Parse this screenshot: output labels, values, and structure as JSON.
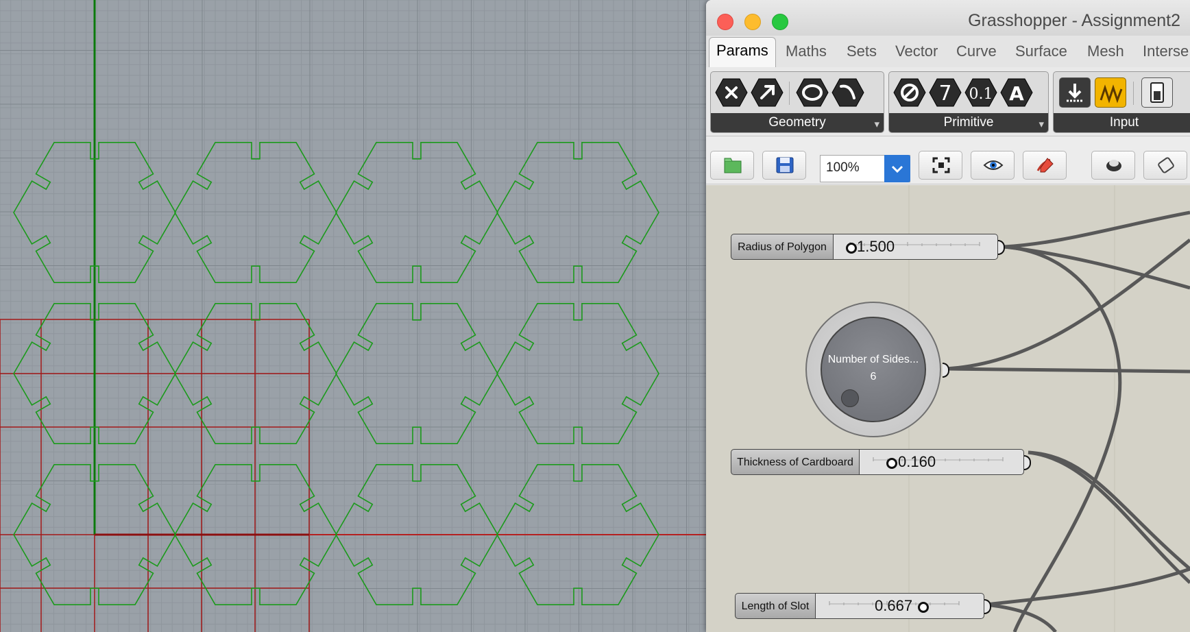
{
  "window": {
    "title": "Grasshopper - Assignment2"
  },
  "tabs": [
    "Params",
    "Maths",
    "Sets",
    "Vector",
    "Curve",
    "Surface",
    "Mesh",
    "Interse"
  ],
  "ribbon": {
    "groups": [
      {
        "label": "Geometry",
        "icons": [
          "delete-icon",
          "arrow-icon",
          "circle-icon",
          "curve-icon"
        ]
      },
      {
        "label": "Primitive",
        "icons": [
          "null-icon",
          "integer-icon",
          "number-icon",
          "text-icon"
        ]
      },
      {
        "label": "Input",
        "icons": [
          "import-icon",
          "graph-mapper-icon",
          "toggle-icon"
        ]
      }
    ],
    "integer_glyph": "7",
    "number_glyph": "0.1",
    "text_glyph": "A"
  },
  "toolbar": {
    "zoom": "100%",
    "buttons": [
      "open-file-icon",
      "save-file-icon",
      "zoom-extents-icon",
      "preview-eye-icon",
      "sketch-pen-icon",
      "display-mode-icon",
      "bake-icon"
    ]
  },
  "canvas": {
    "sliders": [
      {
        "name": "Radius of Polygon",
        "value": "1.500"
      },
      {
        "name": "Thickness of Cardboard",
        "value": "0.160"
      },
      {
        "name": "Length of Slot",
        "value": "0.667"
      }
    ],
    "dial": {
      "name": "Number of Sides...",
      "value": "6"
    }
  },
  "colors": {
    "viewport_bg": "#9aa1a8",
    "geometry": "#1b9a1b",
    "grid_red": "#a31818",
    "canvas_bg": "#d4d2c7"
  }
}
